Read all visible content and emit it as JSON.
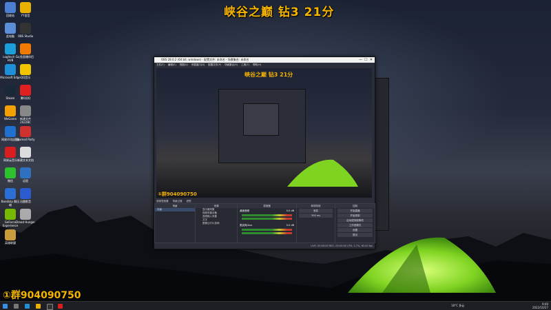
{
  "overlay": {
    "title": "峡谷之巅 钻3 21分",
    "group": "①群904090750"
  },
  "desktop_icons": [
    {
      "label": "回收站",
      "color": "#4a7fd1",
      "icon": "recycle-bin-icon"
    },
    {
      "label": "YY语音",
      "color": "#e8b000",
      "icon": "yy-icon"
    },
    {
      "label": "此电脑",
      "color": "#5a8fd8",
      "icon": "this-pc-icon"
    },
    {
      "label": "OBS Studio",
      "color": "#333333",
      "icon": "obs-icon"
    },
    {
      "label": "Logitech G HUB",
      "color": "#1a9fd8",
      "icon": "logitech-icon"
    },
    {
      "label": "斗鱼直播伴侣",
      "color": "#f07b00",
      "icon": "douyu-icon"
    },
    {
      "label": "Microsoft Edge",
      "color": "#1f8fd8",
      "icon": "edge-icon"
    },
    {
      "label": "QQ音乐",
      "color": "#f2c500",
      "icon": "qq-music-icon"
    },
    {
      "label": "Steam",
      "color": "#1b2838",
      "icon": "steam-icon"
    },
    {
      "label": "腾讯QQ",
      "color": "#e02020",
      "icon": "qq-icon"
    },
    {
      "label": "WeGame",
      "color": "#f4a000",
      "icon": "wegame-icon"
    },
    {
      "label": "新建文件 2022BC",
      "color": "#888888",
      "icon": "file-icon"
    },
    {
      "label": "网易UU加速器",
      "color": "#2070d0",
      "icon": "uu-icon"
    },
    {
      "label": "Foxmail Party",
      "color": "#d03030",
      "icon": "foxmail-icon"
    },
    {
      "label": "网易云音乐",
      "color": "#d81e1e",
      "icon": "netease-music-icon"
    },
    {
      "label": "新建文本文档",
      "color": "#dddddd",
      "icon": "text-file-icon"
    },
    {
      "label": "微信",
      "color": "#2ec12e",
      "icon": "wechat-icon"
    },
    {
      "label": "远程",
      "color": "#3070c0",
      "icon": "remote-icon"
    },
    {
      "label": "Bandizip 解压缩",
      "color": "#2a6ed6",
      "icon": "bandizip-icon"
    },
    {
      "label": "迅雷影音",
      "color": "#2a5bd0",
      "icon": "xunlei-icon"
    },
    {
      "label": "GeForce Experience",
      "color": "#76b900",
      "icon": "geforce-icon"
    },
    {
      "label": "Dread Hunger",
      "color": "#aaaaaa",
      "icon": "dread-hunger-icon"
    },
    {
      "label": "英雄联盟",
      "color": "#c89b3c",
      "icon": "lol-icon"
    }
  ],
  "obs": {
    "window_title": "OBS 28.0.2 (64 bit, windows) - 配置文件: 未命名 - 场景集合: 未命名",
    "menu": [
      "文件(F)",
      "编辑(E)",
      "视图(V)",
      "停靠窗口(D)",
      "配置文件(P)",
      "场景集合(S)",
      "工具(T)",
      "帮助(H)"
    ],
    "preview_tabs": [
      "音频混音器",
      "场景过渡",
      "滤镜"
    ],
    "docks": {
      "scenes": {
        "title": "场景",
        "items": [
          "场景"
        ]
      },
      "sources": {
        "title": "来源",
        "items": [
          "显示器采集",
          "视频采集设备",
          "音频输入采集",
          "文字",
          "图像幻灯片放映"
        ]
      },
      "mixer": {
        "title": "混音器",
        "tracks": [
          {
            "name": "桌面音频",
            "db": "0.0 dB"
          },
          {
            "name": "麦克风/Aux",
            "db": "0.0 dB"
          }
        ]
      },
      "transitions": {
        "title": "转场特效",
        "type": "渐变",
        "duration": "300 ms"
      },
      "controls": {
        "title": "控制",
        "buttons": [
          "开始直播",
          "开始录制",
          "启动虚拟摄像机",
          "工作室模式",
          "设置",
          "退出"
        ]
      }
    },
    "status": "LIVE: 00:00:00  REC: 00:00:00  CPU: 2.7%, 60.00 fps"
  },
  "taskbar": {
    "weather": "18°C 多云",
    "time": "9:00",
    "date": "2022/10/27"
  }
}
